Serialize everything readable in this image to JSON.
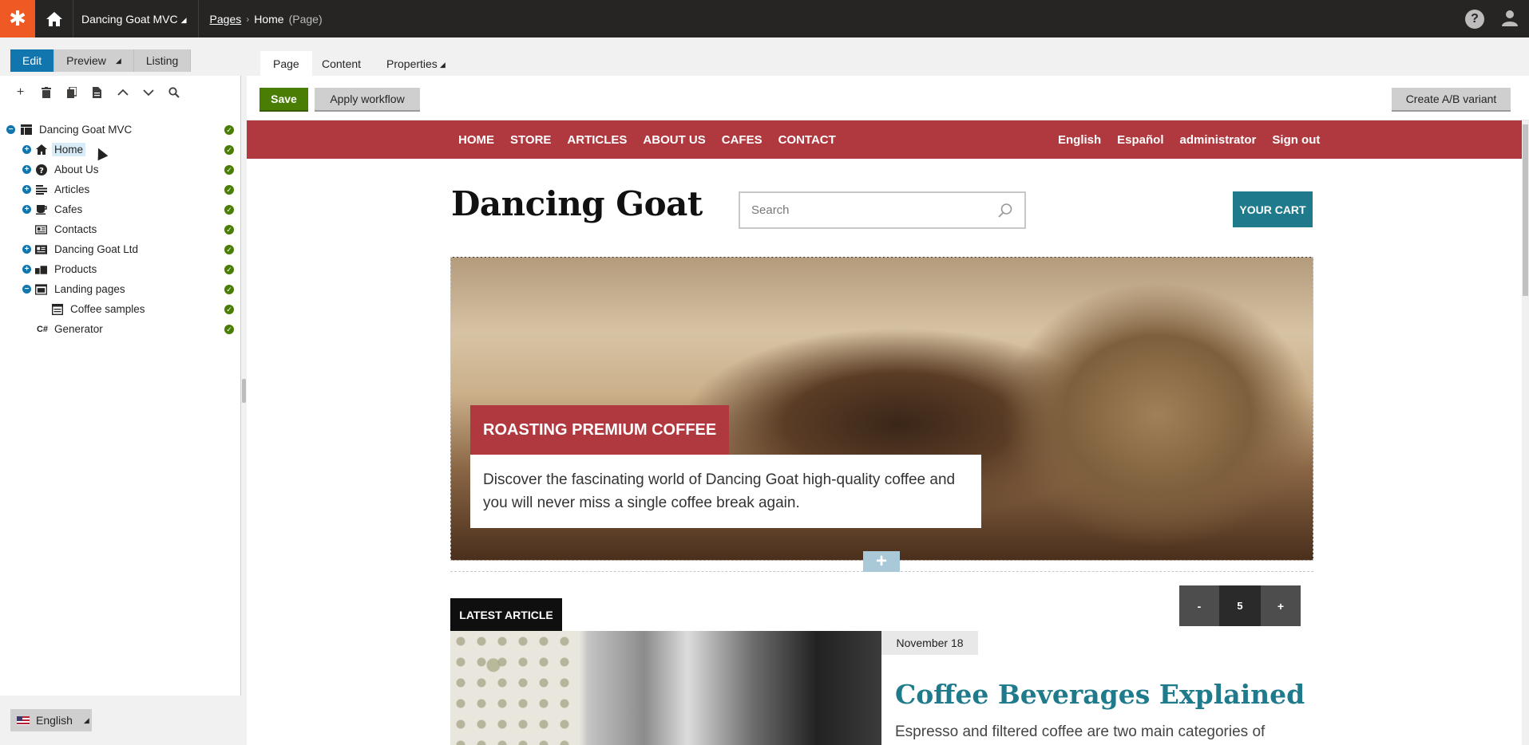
{
  "topbar": {
    "site_name": "Dancing Goat MVC",
    "breadcrumb": {
      "root": "Pages",
      "current": "Home",
      "type": "(Page)"
    }
  },
  "modes": {
    "edit": "Edit",
    "preview": "Preview",
    "listing": "Listing"
  },
  "tree": {
    "nodes": [
      {
        "label": "Dancing Goat MVC"
      },
      {
        "label": "Home"
      },
      {
        "label": "About Us"
      },
      {
        "label": "Articles"
      },
      {
        "label": "Cafes"
      },
      {
        "label": "Contacts"
      },
      {
        "label": "Dancing Goat Ltd"
      },
      {
        "label": "Products"
      },
      {
        "label": "Landing pages"
      },
      {
        "label": "Coffee samples"
      },
      {
        "label": "Generator"
      }
    ]
  },
  "culture": {
    "label": "English"
  },
  "tabs": {
    "page": "Page",
    "content": "Content",
    "properties": "Properties"
  },
  "toolbar": {
    "save": "Save",
    "apply_workflow": "Apply workflow",
    "create_ab": "Create A/B variant"
  },
  "site": {
    "nav": [
      "HOME",
      "STORE",
      "ARTICLES",
      "ABOUT US",
      "CAFES",
      "CONTACT"
    ],
    "right": [
      "English",
      "Español",
      "administrator",
      "Sign out"
    ],
    "brand": "Dancing Goat",
    "search_placeholder": "Search",
    "cart": "YOUR CART",
    "hero_title": "ROASTING PREMIUM COFFEE",
    "hero_text": "Discover the fascinating world of Dancing Goat high-quality coffee and you will never miss a single coffee break again.",
    "latest_label": "LATEST ARTICLE",
    "counter": {
      "minus": "-",
      "value": "5",
      "plus": "+"
    },
    "article_date": "November 18",
    "article_title": "Coffee Beverages Explained",
    "article_text": "Espresso and filtered coffee are two main categories of"
  }
}
